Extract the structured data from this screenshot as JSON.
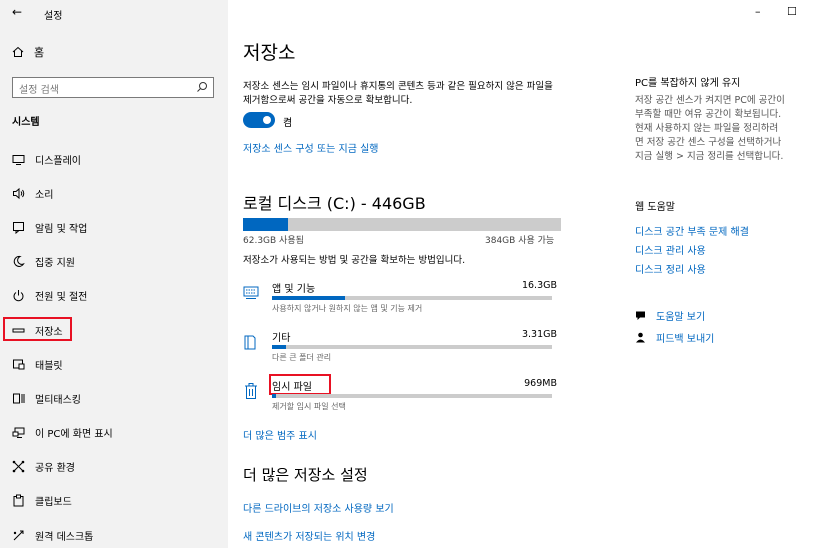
{
  "window": {
    "app_title": "설정",
    "minimize": "–",
    "maximize": "☐"
  },
  "sidebar": {
    "home_label": "홈",
    "search_placeholder": "설정 검색",
    "section_label": "시스템",
    "items": [
      {
        "label": "디스플레이",
        "icon": "monitor-icon"
      },
      {
        "label": "소리",
        "icon": "speaker-icon"
      },
      {
        "label": "알림 및 작업",
        "icon": "notification-icon"
      },
      {
        "label": "집중 지원",
        "icon": "moon-icon"
      },
      {
        "label": "전원 및 절전",
        "icon": "power-icon"
      },
      {
        "label": "저장소",
        "icon": "storage-icon",
        "active": true
      },
      {
        "label": "태블릿",
        "icon": "tablet-icon"
      },
      {
        "label": "멀티태스킹",
        "icon": "multitasking-icon"
      },
      {
        "label": "이 PC에 화면 표시",
        "icon": "project-icon"
      },
      {
        "label": "공유 환경",
        "icon": "share-icon"
      },
      {
        "label": "클립보드",
        "icon": "clipboard-icon"
      },
      {
        "label": "원격 데스크톱",
        "icon": "remote-desktop-icon"
      }
    ]
  },
  "main": {
    "title": "저장소",
    "description": "저장소 센스는 임시 파일이나 휴지통의 콘텐츠 등과 같은 필요하지 않은 파일을 제거함으로써 공간을 자동으로 확보합니다.",
    "toggle_label": "켬",
    "configure_link": "저장소 센스 구성 또는 지금 실행",
    "disk_title": "로컬 디스크 (C:) - 446GB",
    "used_label": "62.3GB 사용됨",
    "free_label": "384GB 사용 가능",
    "usage_fraction": 0.14,
    "usage_info": "저장소가 사용되는 방법 및 공간을 확보하는 방법입니다.",
    "categories": [
      {
        "name": "앱 및 기능",
        "size": "16.3GB",
        "sub": "사용하지 않거나 원하지 않는 앱 및 기능 제거",
        "fraction": 0.26,
        "icon": "apps-icon"
      },
      {
        "name": "기타",
        "size": "3.31GB",
        "sub": "다른 큰 폴더 관리",
        "fraction": 0.05,
        "icon": "folder-icon"
      },
      {
        "name": "임시 파일",
        "size": "969MB",
        "sub": "제거할 임시 파일 선택",
        "fraction": 0.015,
        "icon": "trash-icon",
        "highlight": true
      }
    ],
    "more_categories_link": "더 많은 범주 표시",
    "more_settings_title": "더 많은 저장소 설정",
    "other_drives_link": "다른 드라이브의 저장소 사용량 보기",
    "change_location_link": "새 콘텐츠가 저장되는 위치 변경"
  },
  "right": {
    "keep_pc_title": "PC를 복잡하지 않게 유지",
    "keep_pc_lines": [
      "저장 공간 센스가 켜지면 PC에 공간이",
      "부족할 때만 여유 공간이 확보됩니다.",
      "현재 사용하지 않는 파일을 정리하려",
      "면 저장 공간 센스 구성을 선택하거나",
      "지금 실행 > 지금 정리를 선택합니다."
    ],
    "web_help_title": "웹 도움말",
    "help_links": [
      "디스크 공간 부족 문제 해결",
      "디스크 관리 사용",
      "디스크 정리 사용"
    ],
    "get_help": "도움말 보기",
    "feedback": "피드백 보내기"
  }
}
